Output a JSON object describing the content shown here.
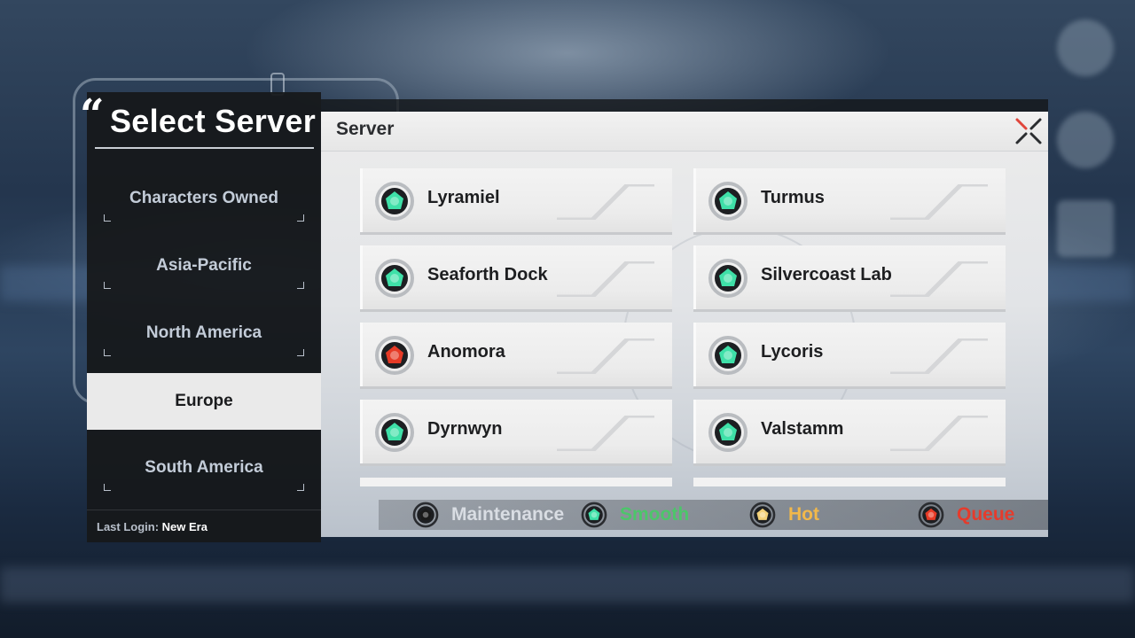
{
  "panel": {
    "title": "Select Server",
    "regions": [
      {
        "label": "Characters Owned",
        "active": false
      },
      {
        "label": "Asia-Pacific",
        "active": false
      },
      {
        "label": "North America",
        "active": false
      },
      {
        "label": "Europe",
        "active": true
      },
      {
        "label": "South America",
        "active": false
      }
    ],
    "last_login_label": "Last Login:",
    "last_login_value": "New Era"
  },
  "server_window": {
    "title": "Server",
    "servers": [
      {
        "name": "Lyramiel",
        "status": "smooth"
      },
      {
        "name": "Turmus",
        "status": "smooth"
      },
      {
        "name": "Seaforth Dock",
        "status": "smooth"
      },
      {
        "name": "Silvercoast Lab",
        "status": "smooth"
      },
      {
        "name": "Anomora",
        "status": "queue"
      },
      {
        "name": "Lycoris",
        "status": "smooth"
      },
      {
        "name": "Dyrnwyn",
        "status": "smooth"
      },
      {
        "name": "Valstamm",
        "status": "smooth"
      }
    ]
  },
  "legend": [
    {
      "label": "Maintenance",
      "status": "maintenance",
      "color": "#d9dde3"
    },
    {
      "label": "Smooth",
      "status": "smooth",
      "color": "#4cc66a"
    },
    {
      "label": "Hot",
      "status": "hot",
      "color": "#f2b84a"
    },
    {
      "label": "Queue",
      "status": "queue",
      "color": "#e53b2c"
    }
  ],
  "status_colors": {
    "smooth": "#3fe0a8",
    "queue": "#e63a26",
    "hot": "#f4d27a",
    "maintenance": "#1a1a1a"
  }
}
